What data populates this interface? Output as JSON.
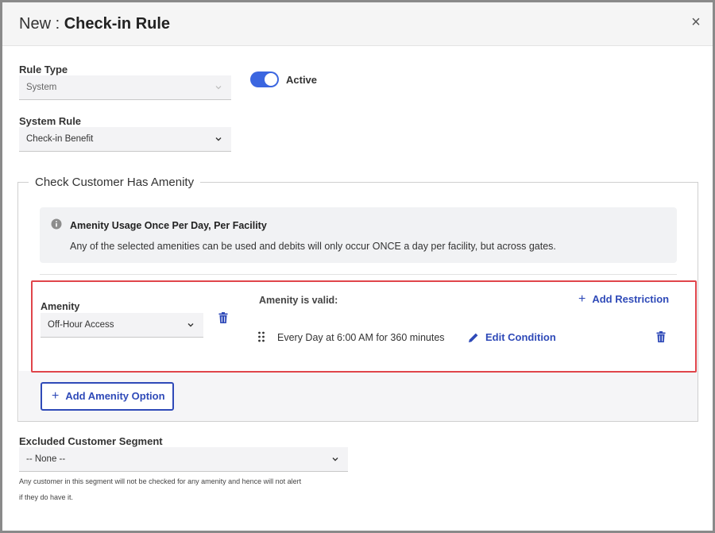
{
  "header": {
    "title_prefix": "New : ",
    "title_name": "Check-in Rule",
    "close_label": "×"
  },
  "rule_type": {
    "label": "Rule Type",
    "value": "System"
  },
  "active_toggle": {
    "label": "Active",
    "on": true
  },
  "system_rule": {
    "label": "System Rule",
    "value": "Check-in Benefit"
  },
  "section": {
    "legend": "Check Customer Has Amenity",
    "info_title": "Amenity Usage Once Per Day, Per Facility",
    "info_text": "Any of the selected amenities can be used and debits will only occur ONCE a day per facility, but across gates."
  },
  "amenity": {
    "label": "Amenity",
    "value": "Off-Hour Access",
    "valid_label": "Amenity is valid:",
    "add_restriction_label": "Add Restriction",
    "condition_text": "Every Day at 6:00 AM for 360 minutes",
    "edit_condition_label": "Edit Condition"
  },
  "add_amenity_option_label": "Add Amenity Option",
  "excluded_segment": {
    "label": "Excluded Customer Segment",
    "value": "-- None --",
    "help_line1": "Any customer in this segment will not be checked for any amenity and hence will not alert",
    "help_line2": "if they do have it."
  },
  "colors": {
    "accent": "#2f4ab8",
    "toggle_on": "#3b66e0",
    "highlight": "#e0454b"
  },
  "icons": [
    "close-icon",
    "chevron-down-icon",
    "info-icon",
    "trash-icon",
    "plus-icon",
    "drag-handle-icon",
    "pencil-icon"
  ]
}
